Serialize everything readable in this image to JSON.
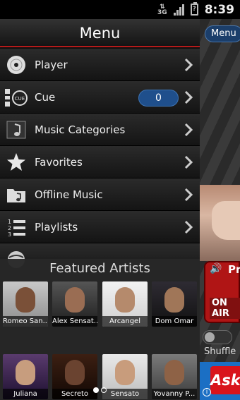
{
  "status_bar": {
    "network": "3G",
    "battery": "?",
    "time": "8:39"
  },
  "player": {
    "menu_button": "Menu",
    "on_air_text": "Pr",
    "on_air_label": "ON AIR",
    "shuffle_label": "Shuffle",
    "ad_logo": "Ask",
    "info_glyph": "i"
  },
  "drawer": {
    "title": "Menu",
    "items": [
      {
        "label": "Player",
        "icon": "disc-icon"
      },
      {
        "label": "Cue",
        "icon": "cue-icon",
        "badge": "0"
      },
      {
        "label": "Music Categories",
        "icon": "music-note-icon"
      },
      {
        "label": "Favorites",
        "icon": "star-icon"
      },
      {
        "label": "Offline Music",
        "icon": "folder-music-icon"
      },
      {
        "label": "Playlists",
        "icon": "numbered-list-icon"
      }
    ]
  },
  "featured": {
    "title": "Featured Artists",
    "artists": [
      {
        "name": "Romeo San..."
      },
      {
        "name": "Alex Sensat..."
      },
      {
        "name": "Arcangel"
      },
      {
        "name": "Dom Omar"
      },
      {
        "name": "Juliana"
      },
      {
        "name": "Secreto"
      },
      {
        "name": "Sensato"
      },
      {
        "name": "Yovanny P..."
      }
    ],
    "page_dots": {
      "total": 2,
      "active": 1
    }
  },
  "colors": {
    "accent_red": "#b51a1a",
    "badge_blue": "#1f4f8c"
  }
}
